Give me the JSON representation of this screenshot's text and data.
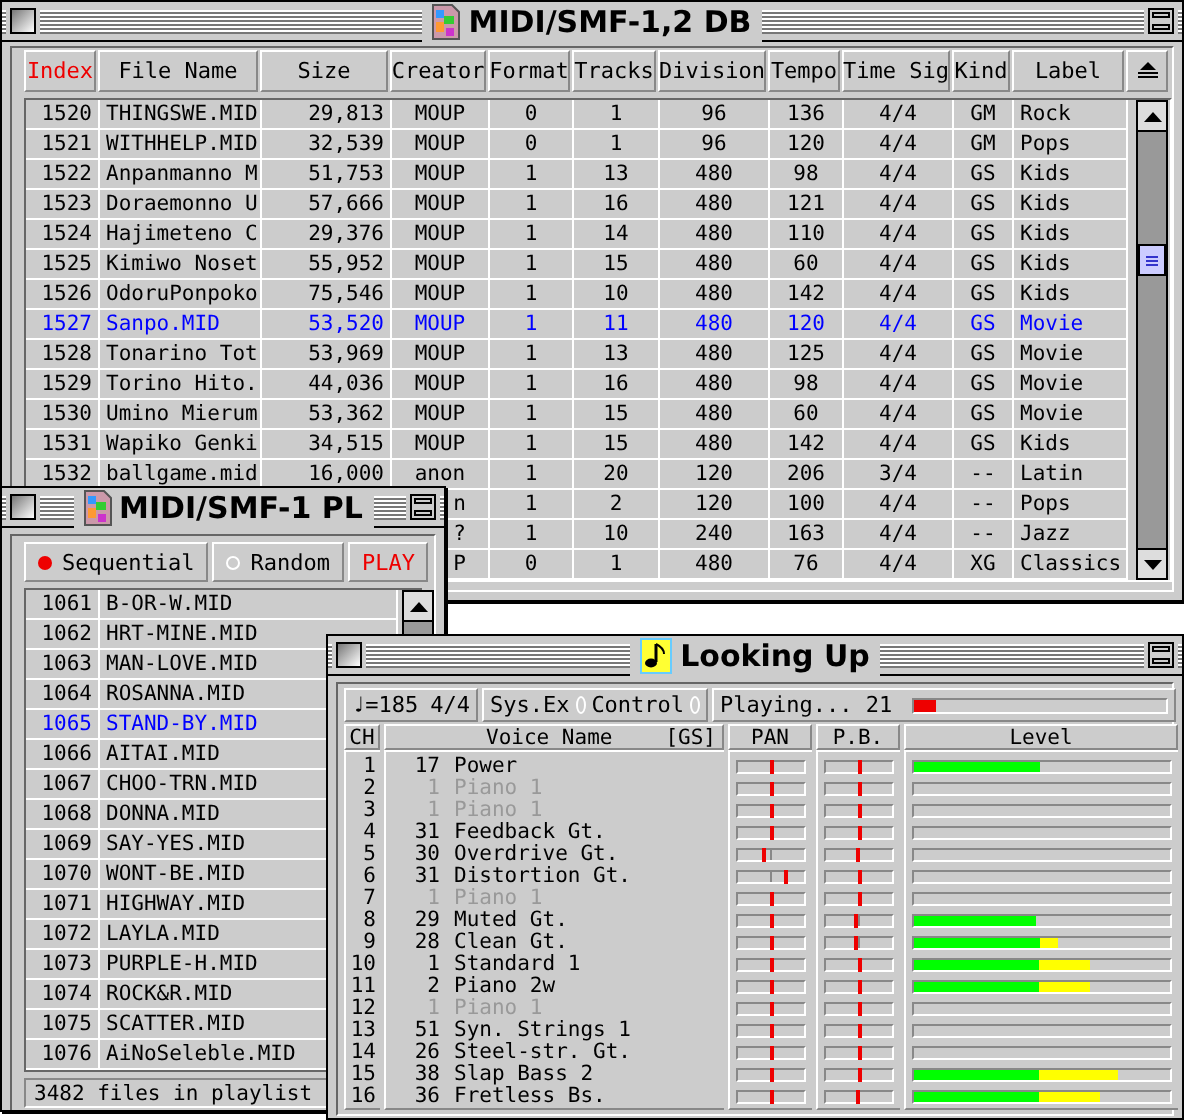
{
  "database_window": {
    "title": "MIDI/SMF-1,2 DB",
    "columns": [
      {
        "label": "Index",
        "sorted": true
      },
      {
        "label": "File Name",
        "sorted": false
      },
      {
        "label": "Size",
        "sorted": false
      },
      {
        "label": "Creator",
        "sorted": false
      },
      {
        "label": "Format",
        "sorted": false
      },
      {
        "label": "Tracks",
        "sorted": false
      },
      {
        "label": "Division",
        "sorted": false
      },
      {
        "label": "Tempo",
        "sorted": false
      },
      {
        "label": "Time Sig",
        "sorted": false
      },
      {
        "label": "Kind",
        "sorted": false
      },
      {
        "label": "Label",
        "sorted": false
      }
    ],
    "rows": [
      {
        "cells": [
          "1520",
          "THINGSWE.MID",
          "29,813",
          "MOUP",
          "0",
          "1",
          "96",
          "136",
          "4/4",
          "GM",
          "Rock"
        ],
        "selected": false
      },
      {
        "cells": [
          "1521",
          "WITHHELP.MID",
          "32,539",
          "MOUP",
          "0",
          "1",
          "96",
          "120",
          "4/4",
          "GM",
          "Pops"
        ],
        "selected": false
      },
      {
        "cells": [
          "1522",
          "Anpanmanno M",
          "51,753",
          "MOUP",
          "1",
          "13",
          "480",
          "98",
          "4/4",
          "GS",
          "Kids"
        ],
        "selected": false
      },
      {
        "cells": [
          "1523",
          "Doraemonno U",
          "57,666",
          "MOUP",
          "1",
          "16",
          "480",
          "121",
          "4/4",
          "GS",
          "Kids"
        ],
        "selected": false
      },
      {
        "cells": [
          "1524",
          "Hajimeteno C",
          "29,376",
          "MOUP",
          "1",
          "14",
          "480",
          "110",
          "4/4",
          "GS",
          "Kids"
        ],
        "selected": false
      },
      {
        "cells": [
          "1525",
          "Kimiwo Noset",
          "55,952",
          "MOUP",
          "1",
          "15",
          "480",
          "60",
          "4/4",
          "GS",
          "Kids"
        ],
        "selected": false
      },
      {
        "cells": [
          "1526",
          "OdoruPonpoko",
          "75,546",
          "MOUP",
          "1",
          "10",
          "480",
          "142",
          "4/4",
          "GS",
          "Kids"
        ],
        "selected": false
      },
      {
        "cells": [
          "1527",
          "Sanpo.MID",
          "53,520",
          "MOUP",
          "1",
          "11",
          "480",
          "120",
          "4/4",
          "GS",
          "Movie"
        ],
        "selected": true
      },
      {
        "cells": [
          "1528",
          "Tonarino Tot",
          "53,969",
          "MOUP",
          "1",
          "13",
          "480",
          "125",
          "4/4",
          "GS",
          "Movie"
        ],
        "selected": false
      },
      {
        "cells": [
          "1529",
          "Torino Hito.",
          "44,036",
          "MOUP",
          "1",
          "16",
          "480",
          "98",
          "4/4",
          "GS",
          "Movie"
        ],
        "selected": false
      },
      {
        "cells": [
          "1530",
          "Umino Mierum",
          "53,362",
          "MOUP",
          "1",
          "15",
          "480",
          "60",
          "4/4",
          "GS",
          "Movie"
        ],
        "selected": false
      },
      {
        "cells": [
          "1531",
          "Wapiko Genki",
          "34,515",
          "MOUP",
          "1",
          "15",
          "480",
          "142",
          "4/4",
          "GS",
          "Kids"
        ],
        "selected": false
      },
      {
        "cells": [
          "1532",
          "ballgame.mid",
          "16,000",
          "anon",
          "1",
          "20",
          "120",
          "206",
          "3/4",
          "--",
          "Latin"
        ],
        "selected": false
      },
      {
        "cells": [
          null,
          null,
          null,
          "n",
          "1",
          "2",
          "120",
          "100",
          "4/4",
          "--",
          "Pops"
        ],
        "selected": false
      },
      {
        "cells": [
          null,
          null,
          null,
          "?",
          "1",
          "10",
          "240",
          "163",
          "4/4",
          "--",
          "Jazz"
        ],
        "selected": false
      },
      {
        "cells": [
          null,
          null,
          null,
          "P",
          "0",
          "1",
          "480",
          "76",
          "4/4",
          "XG",
          "Classics"
        ],
        "selected": false
      }
    ]
  },
  "playlist_window": {
    "title": "MIDI/SMF-1 PL",
    "modes": [
      {
        "label": "Sequential",
        "selected": true
      },
      {
        "label": "Random",
        "selected": false
      }
    ],
    "play_button": "PLAY",
    "rows": [
      {
        "index": "1061",
        "name": "B-OR-W.MID",
        "selected": false
      },
      {
        "index": "1062",
        "name": "HRT-MINE.MID",
        "selected": false
      },
      {
        "index": "1063",
        "name": "MAN-LOVE.MID",
        "selected": false
      },
      {
        "index": "1064",
        "name": "ROSANNA.MID",
        "selected": false
      },
      {
        "index": "1065",
        "name": "STAND-BY.MID",
        "selected": true
      },
      {
        "index": "1066",
        "name": "AITAI.MID",
        "selected": false
      },
      {
        "index": "1067",
        "name": "CHOO-TRN.MID",
        "selected": false
      },
      {
        "index": "1068",
        "name": "DONNA.MID",
        "selected": false
      },
      {
        "index": "1069",
        "name": "SAY-YES.MID",
        "selected": false
      },
      {
        "index": "1070",
        "name": "WONT-BE.MID",
        "selected": false
      },
      {
        "index": "1071",
        "name": "HIGHWAY.MID",
        "selected": false
      },
      {
        "index": "1072",
        "name": "LAYLA.MID",
        "selected": false
      },
      {
        "index": "1073",
        "name": "PURPLE-H.MID",
        "selected": false
      },
      {
        "index": "1074",
        "name": "ROCK&R.MID",
        "selected": false
      },
      {
        "index": "1075",
        "name": "SCATTER.MID",
        "selected": false
      },
      {
        "index": "1076",
        "name": "AiNoSeleble.MID",
        "selected": false
      }
    ],
    "footer": "3482 files in playlist"
  },
  "player_window": {
    "title": "Looking Up",
    "tempo": "♩=185",
    "time_signature": "4/4",
    "indicators": [
      {
        "label": "Sys.Ex",
        "on": false
      },
      {
        "label": "Control",
        "on": false
      }
    ],
    "status": "Playing... 21",
    "progress": {
      "level": 0.09
    },
    "columns": [
      "CH",
      "Voice Name",
      "[GS]",
      "PAN",
      "P.B.",
      "Level"
    ],
    "channels": [
      {
        "ch": "1",
        "program": "17",
        "voice": "Power",
        "active": true,
        "pan": {
          "level": 0.5
        },
        "pitch_bend": {
          "level": 0.5
        },
        "meter": {
          "level": 0.49
        }
      },
      {
        "ch": "2",
        "program": "1",
        "voice": "Piano 1",
        "active": false,
        "pan": {
          "level": 0.5
        },
        "pitch_bend": {
          "level": 0.5
        },
        "meter": {
          "level": 0
        }
      },
      {
        "ch": "3",
        "program": "1",
        "voice": "Piano 1",
        "active": false,
        "pan": {
          "level": 0.5
        },
        "pitch_bend": {
          "level": 0.5
        },
        "meter": {
          "level": 0
        }
      },
      {
        "ch": "4",
        "program": "31",
        "voice": "Feedback Gt.",
        "active": true,
        "pan": {
          "level": 0.5
        },
        "pitch_bend": {
          "level": 0.5
        },
        "meter": {
          "level": 0
        }
      },
      {
        "ch": "5",
        "program": "30",
        "voice": "Overdrive Gt.",
        "active": true,
        "pan": {
          "level": 0.39
        },
        "pitch_bend": {
          "level": 0.47
        },
        "meter": {
          "level": 0
        }
      },
      {
        "ch": "6",
        "program": "31",
        "voice": "Distortion Gt.",
        "active": true,
        "pan": {
          "level": 0.73
        },
        "pitch_bend": {
          "level": 0.5
        },
        "meter": {
          "level": 0
        }
      },
      {
        "ch": "7",
        "program": "1",
        "voice": "Piano 1",
        "active": false,
        "pan": {
          "level": 0.5
        },
        "pitch_bend": {
          "level": 0.5
        },
        "meter": {
          "level": 0
        }
      },
      {
        "ch": "8",
        "program": "29",
        "voice": "Muted Gt.",
        "active": true,
        "pan": {
          "level": 0.5
        },
        "pitch_bend": {
          "level": 0.44
        },
        "meter": {
          "level": 0.48
        }
      },
      {
        "ch": "9",
        "program": "28",
        "voice": "Clean Gt.",
        "active": true,
        "pan": {
          "level": 0.5
        },
        "pitch_bend": {
          "level": 0.44
        },
        "meter": {
          "level": 0.56
        }
      },
      {
        "ch": "10",
        "program": "1",
        "voice": "Standard 1",
        "active": true,
        "pan": {
          "level": 0.5
        },
        "pitch_bend": {
          "level": 0.5
        },
        "meter": {
          "level": 0.69
        }
      },
      {
        "ch": "11",
        "program": "2",
        "voice": "Piano 2w",
        "active": true,
        "pan": {
          "level": 0.5
        },
        "pitch_bend": {
          "level": 0.5
        },
        "meter": {
          "level": 0.69
        }
      },
      {
        "ch": "12",
        "program": "1",
        "voice": "Piano 1",
        "active": false,
        "pan": {
          "level": 0.5
        },
        "pitch_bend": {
          "level": 0.5
        },
        "meter": {
          "level": 0
        }
      },
      {
        "ch": "13",
        "program": "51",
        "voice": "Syn. Strings 1",
        "active": true,
        "pan": {
          "level": 0.5
        },
        "pitch_bend": {
          "level": 0.5
        },
        "meter": {
          "level": 0
        }
      },
      {
        "ch": "14",
        "program": "26",
        "voice": "Steel-str. Gt.",
        "active": true,
        "pan": {
          "level": 0.5
        },
        "pitch_bend": {
          "level": 0.5
        },
        "meter": {
          "level": 0
        }
      },
      {
        "ch": "15",
        "program": "38",
        "voice": "Slap Bass 2",
        "active": true,
        "pan": {
          "level": 0.5
        },
        "pitch_bend": {
          "level": 0.5
        },
        "meter": {
          "level": 0.8
        }
      },
      {
        "ch": "16",
        "program": "36",
        "voice": "Fretless Bs.",
        "active": true,
        "pan": {
          "level": 0.5
        },
        "pitch_bend": {
          "level": 0.47
        },
        "meter": {
          "level": 0.73
        }
      }
    ]
  }
}
